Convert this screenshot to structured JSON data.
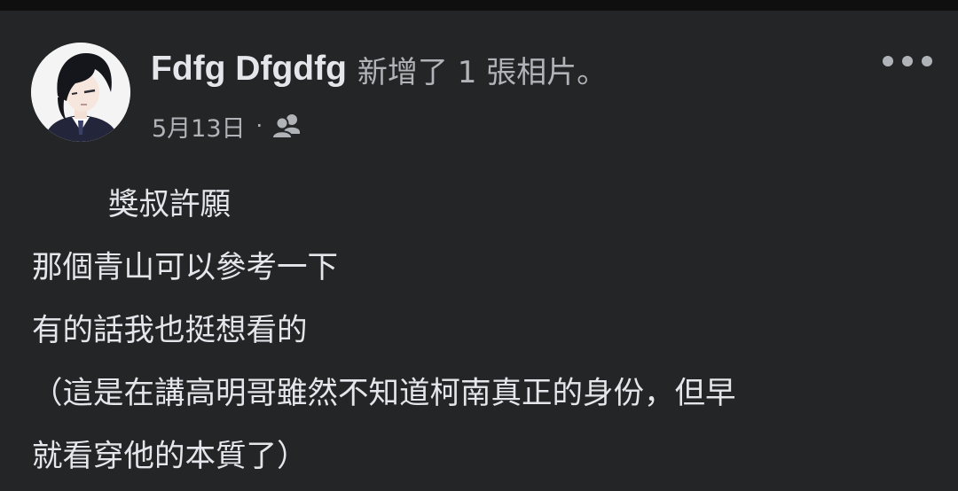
{
  "post": {
    "author_name": "Fdfg Dfgdfg",
    "action_text": "新增了 1 張相片。",
    "date": "5月13日",
    "separator": "·",
    "audience_icon": "friends-icon",
    "more_icon": "more-horizontal-icon",
    "body_lines": [
      "獎叔許願",
      "那個青山可以參考一下",
      "有的話我也挺想看的",
      "（這是在講高明哥雖然不知道柯南真正的身份，但早",
      "就看穿他的本質了）"
    ]
  },
  "colors": {
    "background": "#242526",
    "primary_text": "#e4e6eb",
    "secondary_text": "#b0b3b8"
  }
}
